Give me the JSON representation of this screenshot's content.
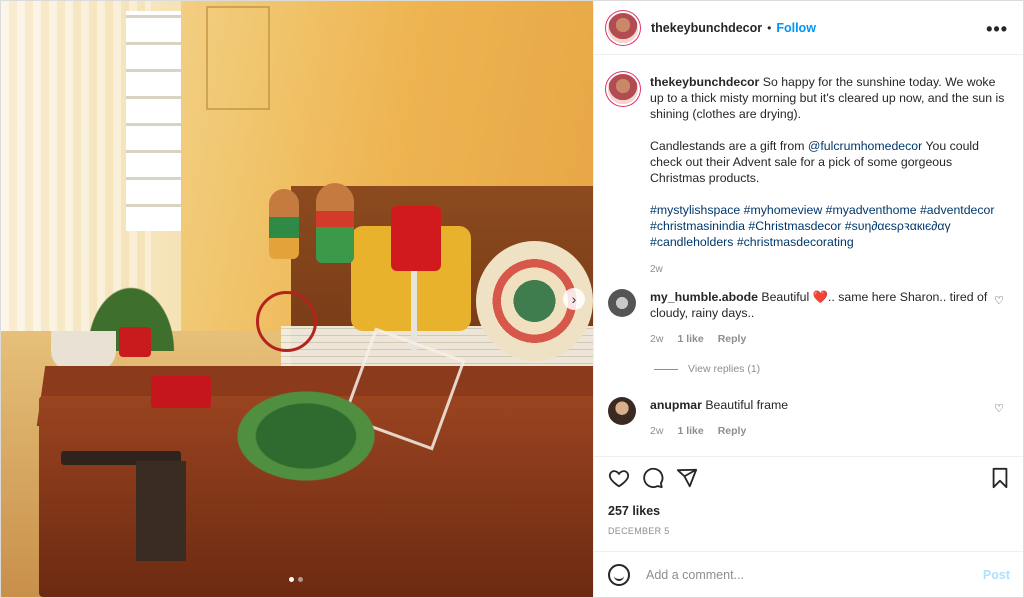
{
  "post": {
    "username": "thekeybunchdecor",
    "separator": "•",
    "follow_label": "Follow",
    "more_icon": "more-options-icon",
    "caption_paragraph_1": "So happy for the sunshine today. We woke up to a thick misty morning but it's cleared up now, and the sun is shining (clothes are drying).",
    "caption_paragraph_2_prefix": "Candlestands are a gift from",
    "caption_mention": "@fulcrumhomedecor",
    "caption_paragraph_2_suffix": "You could check out their Advent sale for a pick of some gorgeous Christmas products.",
    "hashtags": "#mystylishspace #myhomeview #myadventhome #adventdecor #christmasinindia #Christmasdecor #ѕυη∂αєѕρꝛαкιє∂αγ #candleholders #christmasdecorating",
    "caption_time": "2w"
  },
  "comments": [
    {
      "username": "my_humble.abode",
      "text_before": "Beautiful",
      "emoji": "❤️",
      "text_after": ".. same here Sharon.. tired of cloudy, rainy days..",
      "time": "2w",
      "likes": "1 like",
      "reply_label": "Reply"
    },
    {
      "username": "anupmar",
      "text": "Beautiful frame",
      "time": "2w",
      "likes": "1 like",
      "reply_label": "Reply"
    }
  ],
  "view_replies_label": "View replies (1)",
  "stats": {
    "likes": "257 likes",
    "date": "DECEMBER 5"
  },
  "comment_box": {
    "placeholder": "Add a comment...",
    "post_label": "Post"
  },
  "carousel": {
    "next_glyph": "›",
    "count": 2,
    "current": 1
  },
  "colors": {
    "accent_blue": "#0095f6",
    "link_blue": "#00376b",
    "muted": "#8e8e8e",
    "story_ring": "#e1306c"
  }
}
